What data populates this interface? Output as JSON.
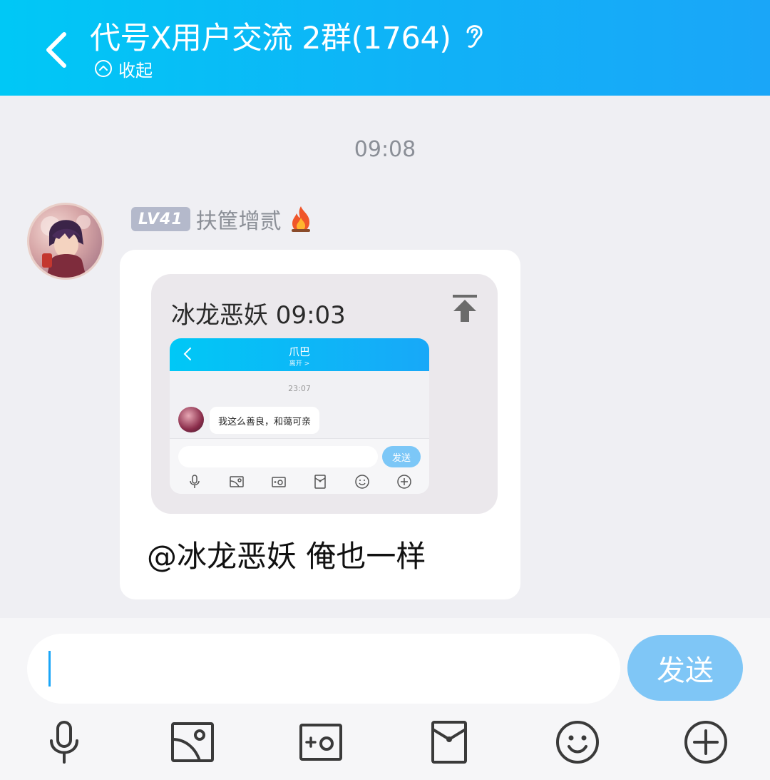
{
  "header": {
    "title": "代号X用户交流 2群(1764)",
    "collapse_label": "收起"
  },
  "chat": {
    "time_separator": "09:08",
    "message": {
      "level_badge": "LV41",
      "sender_name": "扶筐增贰",
      "quoted": {
        "header": "冰龙恶妖 09:03",
        "screenshot": {
          "title": "爪巴",
          "subtitle": "离开 >",
          "time": "23:07",
          "message": "我这么善良，和蔼可亲",
          "send_label": "发送"
        }
      },
      "text": "@冰龙恶妖 俺也一样"
    }
  },
  "input_bar": {
    "value": "",
    "send_label": "发送",
    "tools": [
      "mic-icon",
      "image-icon",
      "camera-icon",
      "red-packet-icon",
      "emoji-icon",
      "plus-icon"
    ]
  },
  "colors": {
    "header_gradient_start": "#00c8f6",
    "header_gradient_end": "#1aa6f8",
    "send_button": "#7fc6f6",
    "chat_background": "#efeff3"
  }
}
